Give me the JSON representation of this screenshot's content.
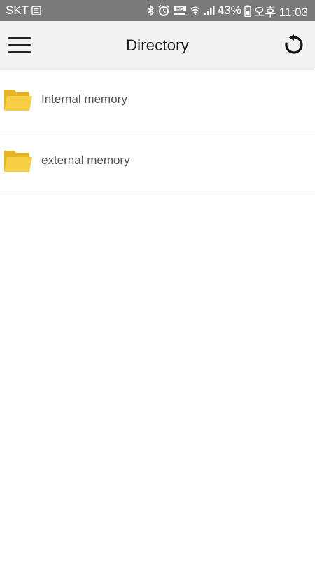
{
  "status_bar": {
    "carrier": "SKT",
    "battery": "43%",
    "time": "오후 11:03",
    "bg_color": "#7a7a7a",
    "icons": [
      "sim-icon",
      "bluetooth-icon",
      "alarm-icon",
      "hd-voice-icon",
      "wifi-icon",
      "signal-icon",
      "battery-icon"
    ]
  },
  "toolbar": {
    "title": "Directory",
    "menu_icon": "hamburger-menu-icon",
    "refresh_icon": "refresh-icon"
  },
  "directories": [
    {
      "label": "Internal memory",
      "icon": "folder-icon"
    },
    {
      "label": "external memory",
      "icon": "folder-icon"
    }
  ],
  "colors": {
    "folder": "#f4c430",
    "toolbar_bg": "#f2f2f2",
    "divider": "#b5b5b5"
  }
}
